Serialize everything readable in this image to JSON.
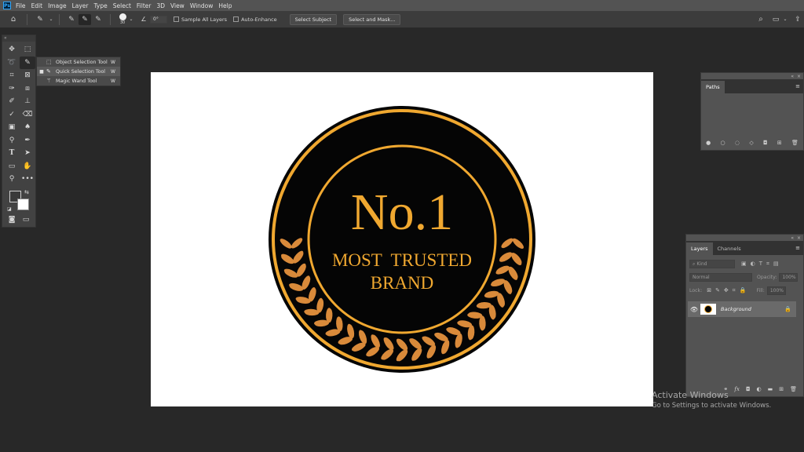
{
  "app": {
    "logo": "Ps"
  },
  "menu": [
    "File",
    "Edit",
    "Image",
    "Layer",
    "Type",
    "Select",
    "Filter",
    "3D",
    "View",
    "Window",
    "Help"
  ],
  "options": {
    "brush_size": "30",
    "angle": "0°",
    "sample_all_layers": "Sample All Layers",
    "auto_enhance": "Auto-Enhance",
    "select_subject": "Select Subject",
    "select_and_mask": "Select and Mask..."
  },
  "toolbar": {
    "collapse": "«"
  },
  "flyout": {
    "items": [
      {
        "label": "Object Selection Tool",
        "key": "W",
        "marker": ""
      },
      {
        "label": "Quick Selection Tool",
        "key": "W",
        "marker": "■"
      },
      {
        "label": "Magic Wand Tool",
        "key": "W",
        "marker": ""
      }
    ]
  },
  "badge": {
    "title": "No.1",
    "line1": "MOST  TRUSTED",
    "line2": "BRAND",
    "gold": "#f0a830",
    "leaf": "#d98a3a",
    "dark": "#050505"
  },
  "paths_panel": {
    "tab": "Paths",
    "collapse": "«",
    "close": "×"
  },
  "layers_panel": {
    "tabs": [
      "Layers",
      "Channels"
    ],
    "search_placeholder": "Kind",
    "blend_mode": "Normal",
    "opacity_label": "Opacity:",
    "opacity_value": "100%",
    "lock_label": "Lock:",
    "fill_label": "Fill:",
    "fill_value": "100%",
    "layer_name": "Background",
    "collapse": "«",
    "close": "×"
  },
  "watermark": {
    "line1": "Activate Windows",
    "line2": "Go to Settings to activate Windows."
  }
}
